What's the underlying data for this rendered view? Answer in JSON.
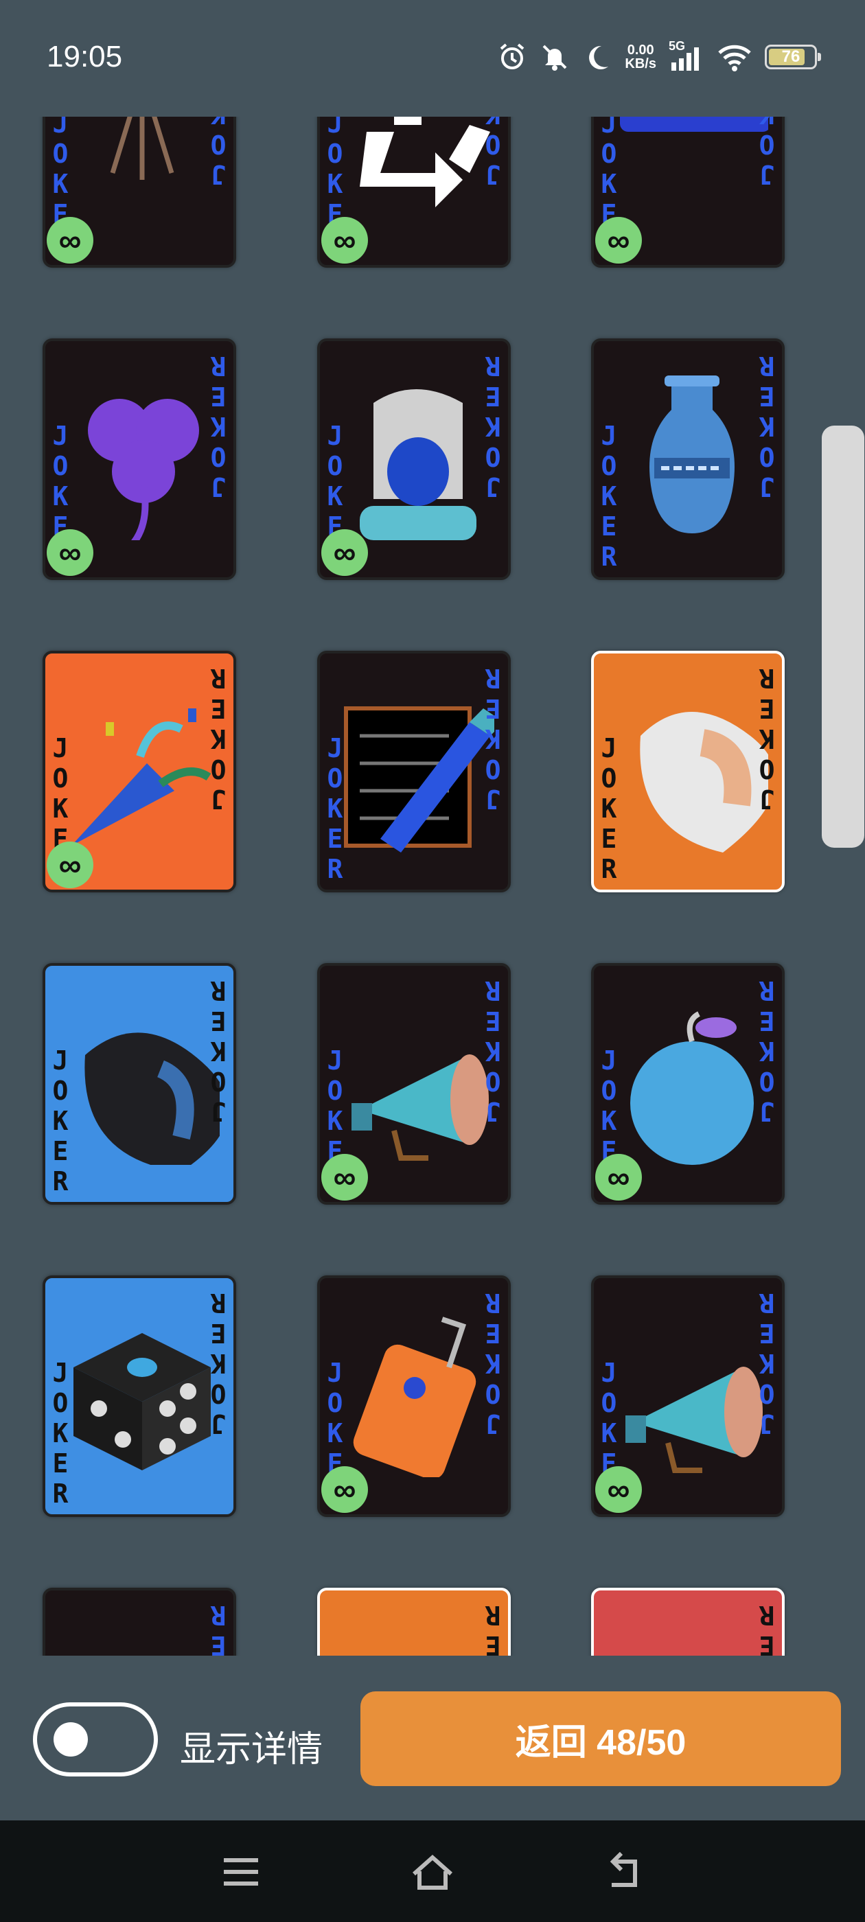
{
  "status_bar": {
    "time": "19:05",
    "net_speed_value": "0.00",
    "net_speed_unit": "KB/s",
    "network_type": "5G",
    "battery": "76",
    "icons": [
      "alarm-icon",
      "mute-icon",
      "moon-icon",
      "signal-icon",
      "wifi-icon",
      "battery-icon"
    ]
  },
  "cards": [
    {
      "art": "tripod-icon",
      "bg": "dark",
      "infinite": true,
      "infinite_symbol": "∞",
      "joker_label": "JOKER"
    },
    {
      "art": "recycle-icon",
      "bg": "dark",
      "infinite": true,
      "infinite_symbol": "∞",
      "joker_label": "JOKER"
    },
    {
      "art": "id-card-icon",
      "bg": "dark",
      "infinite": true,
      "infinite_symbol": "∞",
      "joker_label": "JOKER"
    },
    {
      "art": "clover-icon",
      "bg": "dark",
      "infinite": true,
      "infinite_symbol": "∞",
      "joker_label": "JOKER"
    },
    {
      "art": "hooded-figure-icon",
      "bg": "dark",
      "infinite": true,
      "infinite_symbol": "∞",
      "joker_label": "JOKER"
    },
    {
      "art": "amphora-icon",
      "bg": "dark",
      "infinite": false,
      "infinite_symbol": "",
      "joker_label": "JOKER"
    },
    {
      "art": "party-popper-icon",
      "bg": "orange",
      "infinite": true,
      "infinite_symbol": "∞",
      "joker_label": "JOKER"
    },
    {
      "art": "pencil-icon",
      "bg": "dark",
      "infinite": false,
      "infinite_symbol": "",
      "joker_label": "JOKER"
    },
    {
      "art": "shell-icon",
      "bg": "orange",
      "infinite": false,
      "infinite_symbol": "",
      "joker_label": "JOKER"
    },
    {
      "art": "dark-shell-icon",
      "bg": "blue",
      "infinite": false,
      "infinite_symbol": "",
      "joker_label": "JOKER"
    },
    {
      "art": "megaphone-icon",
      "bg": "dark",
      "infinite": true,
      "infinite_symbol": "∞",
      "joker_label": "JOKER"
    },
    {
      "art": "apple-icon",
      "bg": "dark",
      "infinite": true,
      "infinite_symbol": "∞",
      "joker_label": "JOKER"
    },
    {
      "art": "dice-icon",
      "bg": "blue",
      "infinite": false,
      "infinite_symbol": "",
      "joker_label": "JOKER"
    },
    {
      "art": "suitcase-icon",
      "bg": "dark",
      "infinite": true,
      "infinite_symbol": "∞",
      "joker_label": "JOKER"
    },
    {
      "art": "megaphone-icon",
      "bg": "dark",
      "infinite": true,
      "infinite_symbol": "∞",
      "joker_label": "JOKER"
    },
    {
      "art": "partial-icon",
      "bg": "dark",
      "infinite": false,
      "infinite_symbol": "",
      "joker_label": "JOKER"
    },
    {
      "art": "partial-icon",
      "bg": "orange",
      "infinite": false,
      "infinite_symbol": "",
      "joker_label": "JOKER"
    },
    {
      "art": "partial-icon",
      "bg": "red",
      "infinite": false,
      "infinite_symbol": "",
      "joker_label": "JOKER"
    }
  ],
  "bottom_bar": {
    "toggle_label": "显示详情",
    "toggle_on": false,
    "return_button": "返回 48/50"
  },
  "nav_bar": {
    "icons": [
      "menu-icon",
      "home-icon",
      "back-icon"
    ]
  }
}
